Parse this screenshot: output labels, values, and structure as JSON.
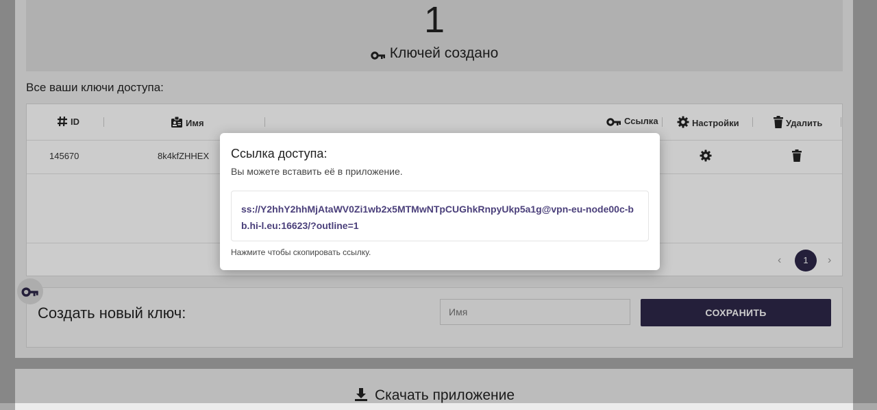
{
  "stats": {
    "count": "1",
    "label": "Ключей создано"
  },
  "keys_section": {
    "title": "Все ваши ключи доступа:"
  },
  "table": {
    "headers": {
      "id": "ID",
      "name": "Имя",
      "link": "Ссылка",
      "settings": "Настройки",
      "delete": "Удалить"
    },
    "rows": [
      {
        "id": "145670",
        "name": "8k4kfZHHEX"
      }
    ],
    "pagination": {
      "current_page": "1",
      "prev": "‹",
      "next": "›"
    }
  },
  "create": {
    "title": "Создать новый ключ:",
    "name_placeholder": "Имя",
    "save_label": "СОХРАНИТЬ"
  },
  "download": {
    "label": "Скачать приложение"
  },
  "modal": {
    "title": "Ссылка доступа:",
    "subtitle": "Вы можете вставить её в приложение.",
    "link": "ss://Y2hhY2hhMjAtaWV0Zi1wb2x5MTMwNTpCUGhkRnpyUkp5a1g@vpn-eu-node00c-bb.hi-l.eu:16623/?outline=1",
    "hint": "Нажмите чтобы скопировать ссылку."
  },
  "colors": {
    "accent": "#2e2749",
    "link_text": "#4a3f7a"
  },
  "icons": [
    "key-icon",
    "hash-icon",
    "id-badge-icon",
    "gear-icon",
    "trash-icon",
    "download-icon"
  ]
}
